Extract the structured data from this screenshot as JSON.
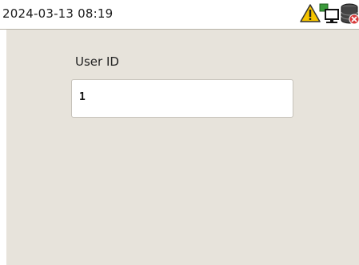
{
  "status_bar": {
    "datetime": "2024-03-13 08:19",
    "icons": [
      "warning-icon",
      "network-computer-icon",
      "database-error-icon"
    ],
    "colors": {
      "warning": "#f5c400",
      "network": "#3a9a3a",
      "error": "#d83a3a"
    }
  },
  "form": {
    "user_id_label": "User ID",
    "user_id_value": "1"
  },
  "colors": {
    "panel_background": "#e7e3db",
    "input_border": "#c6c2ba"
  }
}
